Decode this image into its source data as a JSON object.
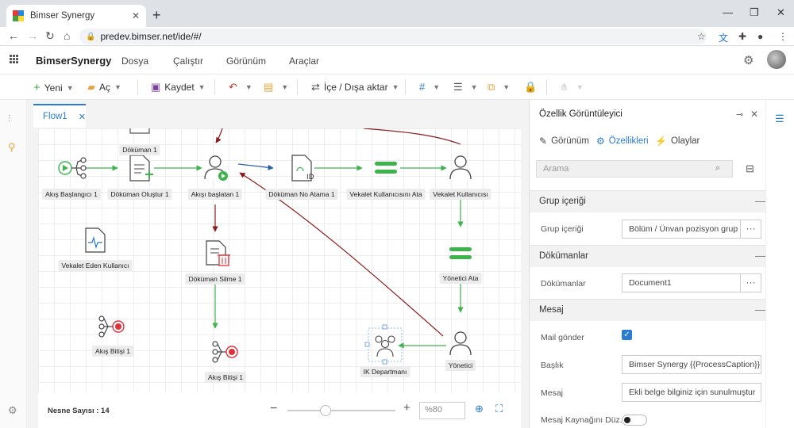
{
  "browser": {
    "tab_title": "Bimser Synergy",
    "tab_close": "✕",
    "new_tab": "+",
    "url": "predev.bimser.net/ide/#/",
    "min": "—",
    "restore": "❐",
    "close": "✕"
  },
  "app": {
    "brand": "BimserSynergy",
    "menu": [
      "Dosya",
      "Çalıştır",
      "Görünüm",
      "Araçlar"
    ]
  },
  "toolbar": {
    "new_label": "Yeni",
    "open_label": "Aç",
    "save_label": "Kaydet",
    "import_export_label": "İçe / Dışa aktar"
  },
  "designer": {
    "tab_label": "Flow1",
    "nodes": [
      {
        "name": "flow-start-node",
        "label": "Akış Başlangıcı 1"
      },
      {
        "name": "create-document-node",
        "label": "Döküman Oluştur 1"
      },
      {
        "name": "flow-initiator-node",
        "label": "Akışı başlatan 1"
      },
      {
        "name": "document-numbering-node",
        "label": "Döküman No Atama 1"
      },
      {
        "name": "assign-proxy-node",
        "label": "Vekalet Kullanıcısını Ata"
      },
      {
        "name": "proxy-user-node",
        "label": "Vekalet Kullanıcısı"
      },
      {
        "name": "document-top-node",
        "label": "Döküman 1"
      },
      {
        "name": "proxy-giver-node",
        "label": "Vekalet Eden Kullanıcı"
      },
      {
        "name": "delete-document-node",
        "label": "Döküman Silme 1"
      },
      {
        "name": "assign-manager-node",
        "label": "Yönetici Ata"
      },
      {
        "name": "flow-end-node-1",
        "label": "Akış Bitişi 1"
      },
      {
        "name": "flow-end-node-2",
        "label": "Akış Bitişi 1"
      },
      {
        "name": "hr-department-node",
        "label": "IK Departmanı"
      },
      {
        "name": "manager-node",
        "label": "Yönetici"
      }
    ],
    "object_count_label": "Nesne Sayısı : 14",
    "zoom_value": "%80",
    "zoom_level": 0.35
  },
  "panel": {
    "title": "Özellik Görüntüleyici",
    "tabs": [
      "Görünüm",
      "Özellikleri",
      "Olaylar"
    ],
    "search_placeholder": "Arama",
    "sections": {
      "group": "Grup içeriği",
      "documents": "Dökümanlar",
      "message": "Mesaj"
    },
    "rows": {
      "group_label": "Grup içeriği",
      "group_value": "Bölüm / Ünvan pozisyon grup",
      "documents_label": "Dökümanlar",
      "documents_value": "Document1",
      "mail_label": "Mail gönder",
      "subject_label": "Başlık",
      "subject_value": "Bimser Synergy {{ProcessCaption}} a",
      "message_label": "Mesaj",
      "message_value": "Ekli belge bilginiz için sunulmuştur",
      "source_label": "Mesaj Kaynağını Düz..."
    },
    "mail_checked": true,
    "source_toggle_on": false
  },
  "colors": {
    "accent": "#2a7bd4",
    "green": "#3cb44b",
    "red_arrow": "#8b1a1a",
    "end_red": "#e0303a"
  }
}
